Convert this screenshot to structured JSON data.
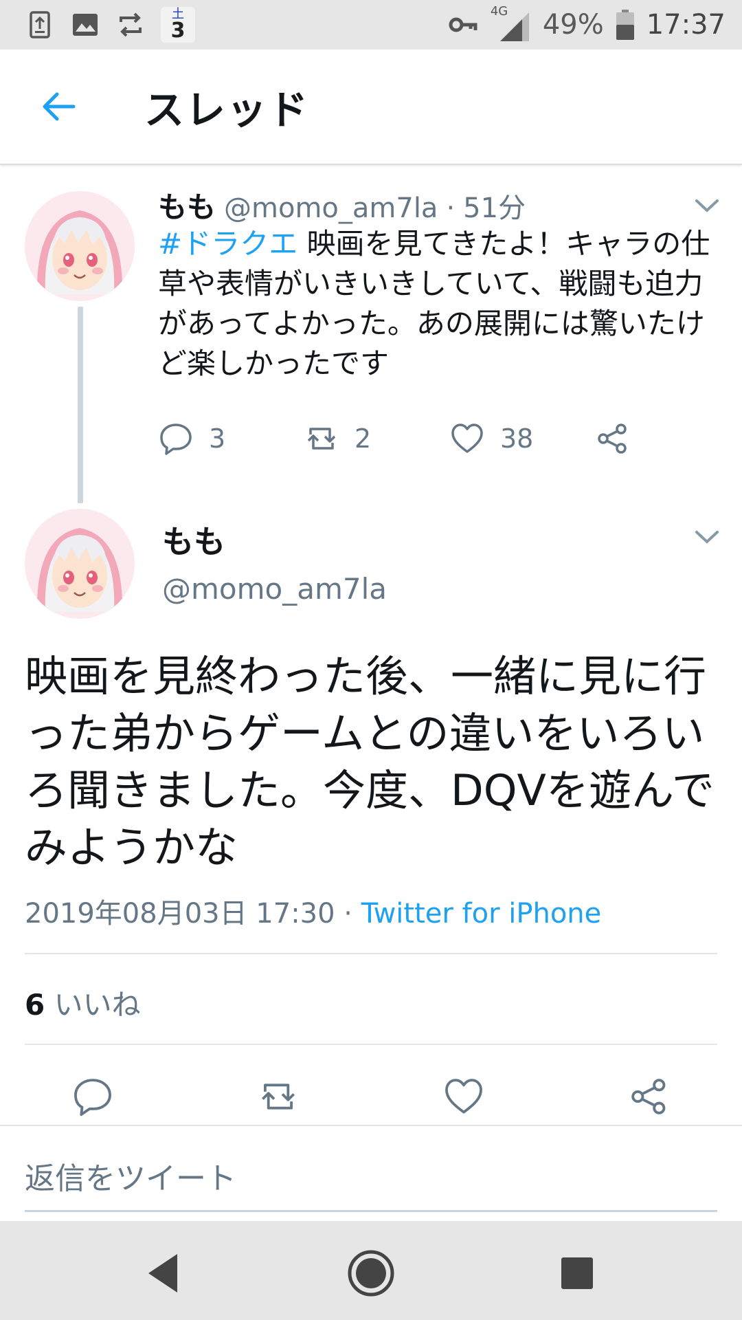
{
  "status_bar": {
    "calendar_top": "土",
    "calendar_day": "3",
    "network": "4G",
    "battery": "49%",
    "time": "17:37",
    "icons": [
      "sim-update-icon",
      "image-icon",
      "sync-icon",
      "calendar-icon",
      "vpn-key-icon",
      "signal-icon",
      "battery-icon"
    ]
  },
  "header": {
    "title": "スレッド",
    "back_icon": "back-arrow-icon"
  },
  "tweet1": {
    "name": "もも",
    "handle": "@momo_am7la",
    "separator": "·",
    "time": "51分",
    "hashtag": "#ドラクエ",
    "text": " 映画を見てきたよ！キャラの仕草や表情がいきいきしていて、戦闘も迫力があってよかった。あの展開には驚いたけど楽しかったです",
    "replies": "3",
    "retweets": "2",
    "likes": "38"
  },
  "tweet2": {
    "name": "もも",
    "handle": "@momo_am7la",
    "text": "映画を見終わった後、一緒に見に行った弟からゲームとの違いをいろいろ聞きました。今度、DQVを遊んでみようかな",
    "timestamp": "2019年08月03日 17:30",
    "separator": " · ",
    "client": "Twitter for iPhone",
    "likes_count": "6",
    "likes_label": " いいね"
  },
  "reply": {
    "placeholder": "返信をツイート"
  },
  "colors": {
    "accent": "#1da1f2",
    "text": "#14171a",
    "secondary": "#657786",
    "status_bar_bg": "#e6e6e6"
  }
}
